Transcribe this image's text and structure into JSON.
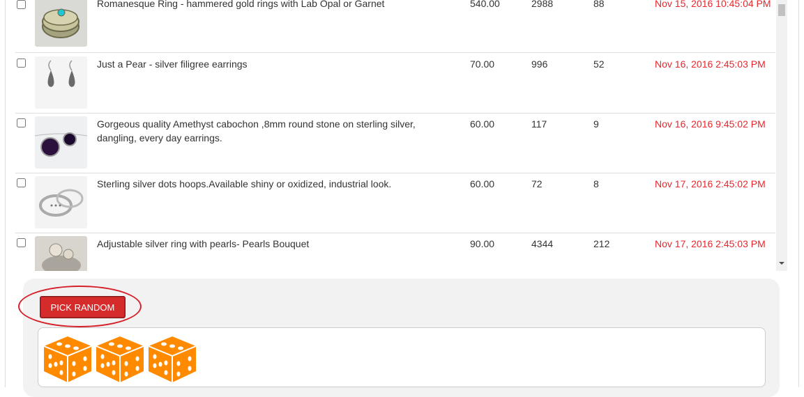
{
  "listings": [
    {
      "title": "Romanesque Ring - hammered gold rings with Lab Opal or Garnet",
      "price": "540.00",
      "views": "2988",
      "favorites": "88",
      "date": "Nov 15, 2016 10:45:04 PM",
      "thumb": "ring-opal"
    },
    {
      "title": "Just a Pear - silver filigree earrings",
      "price": "70.00",
      "views": "996",
      "favorites": "52",
      "date": "Nov 16, 2016 2:45:03 PM",
      "thumb": "filigree-earrings"
    },
    {
      "title": "Gorgeous quality Amethyst cabochon ,8mm round stone on sterling silver, dangling, every day earrings.",
      "price": "60.00",
      "views": "117",
      "favorites": "9",
      "date": "Nov 16, 2016 9:45:02 PM",
      "thumb": "amethyst-earrings"
    },
    {
      "title": "Sterling silver dots hoops.Available shiny or oxidized, industrial look.",
      "price": "60.00",
      "views": "72",
      "favorites": "8",
      "date": "Nov 17, 2016 2:45:02 PM",
      "thumb": "silver-hoops"
    },
    {
      "title": "Adjustable silver ring with pearls- Pearls Bouquet",
      "price": "90.00",
      "views": "4344",
      "favorites": "212",
      "date": "Nov 17, 2016 2:45:03 PM",
      "thumb": "pearl-ring"
    }
  ],
  "picker": {
    "button_label": "PICK RANDOM",
    "dice_icons": [
      "dice-icon",
      "dice-icon",
      "dice-icon"
    ]
  },
  "colors": {
    "date_red": "#e8262c",
    "button_red": "#d62b2b",
    "dice_orange": "#ff8a00"
  }
}
